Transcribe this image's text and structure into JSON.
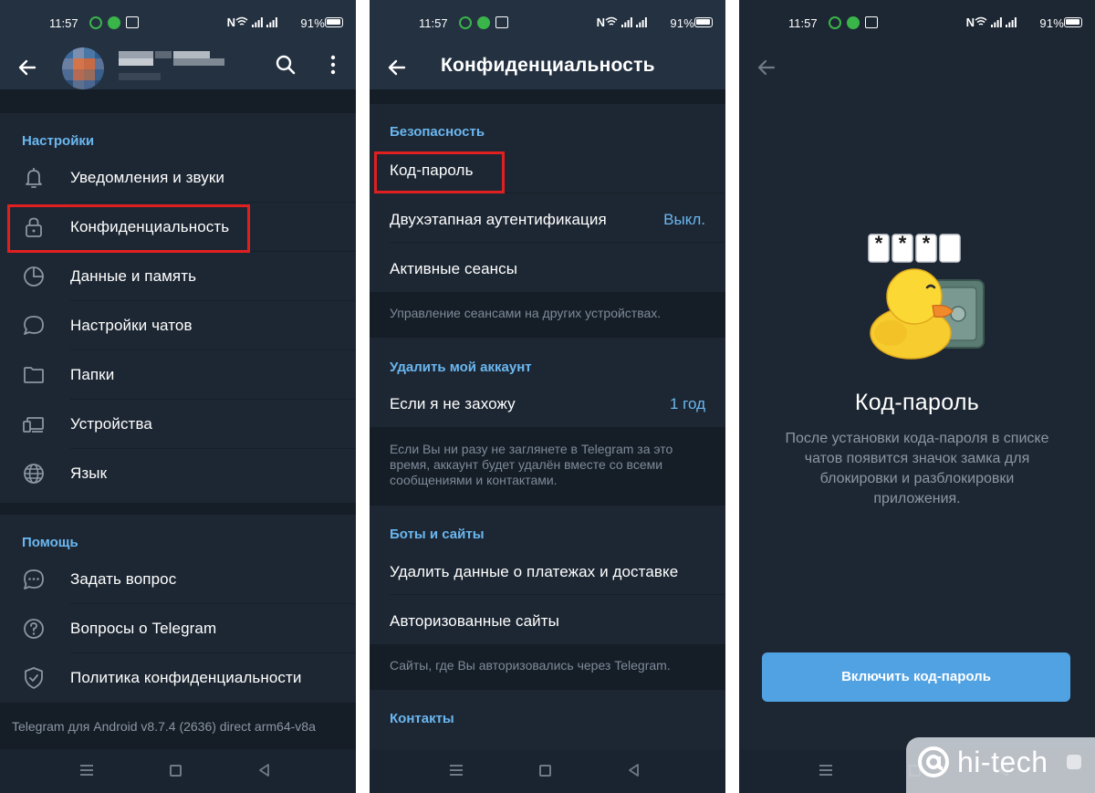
{
  "status_bar": {
    "time": "11:57",
    "battery": "91%",
    "nfc": "N"
  },
  "screen1": {
    "settings_header": "Настройки",
    "settings_items": [
      {
        "label": "Уведомления и звуки",
        "icon": "bell-icon"
      },
      {
        "label": "Конфиденциальность",
        "icon": "lock-icon"
      },
      {
        "label": "Данные и память",
        "icon": "pie-chart-icon"
      },
      {
        "label": "Настройки чатов",
        "icon": "chat-bubble-icon"
      },
      {
        "label": "Папки",
        "icon": "folder-icon"
      },
      {
        "label": "Устройства",
        "icon": "devices-icon"
      },
      {
        "label": "Язык",
        "icon": "globe-icon"
      }
    ],
    "help_header": "Помощь",
    "help_items": [
      {
        "label": "Задать вопрос",
        "icon": "ask-question-icon"
      },
      {
        "label": "Вопросы о Telegram",
        "icon": "question-circle-icon"
      },
      {
        "label": "Политика конфиденциальности",
        "icon": "shield-check-icon"
      }
    ],
    "version": "Telegram для Android v8.7.4 (2636) direct arm64-v8a"
  },
  "screen2": {
    "title": "Конфиденциальность",
    "security_header": "Безопасность",
    "passcode": "Код-пароль",
    "two_step": "Двухэтапная аутентификация",
    "two_step_value": "Выкл.",
    "active_sessions": "Активные сеансы",
    "sessions_hint": "Управление сеансами на других устройствах.",
    "delete_header": "Удалить мой аккаунт",
    "if_away": "Если я не захожу",
    "if_away_value": "1 год",
    "delete_hint": "Если Вы ни разу не заглянете в Telegram за это время, аккаунт будет удалён вместе со всеми сообщениями и контактами.",
    "bots_header": "Боты и сайты",
    "delete_payments": "Удалить данные о платежах и доставке",
    "authorized_sites": "Авторизованные сайты",
    "sites_hint": "Сайты, где Вы авторизовались через Telegram.",
    "contacts_header": "Контакты"
  },
  "screen3": {
    "passcode_digits": [
      "*",
      "*",
      "*",
      ""
    ],
    "title": "Код-пароль",
    "description": "После установки кода-пароля в списке чатов появится значок замка для блокировки и разблокировки приложения.",
    "button": "Включить код-пароль"
  },
  "watermark": {
    "text": "hi-tech"
  },
  "colors": {
    "background": "#1d2733",
    "header": "#243141",
    "accent": "#6ab7f0",
    "button": "#50a2e3",
    "highlight": "#e02020"
  }
}
